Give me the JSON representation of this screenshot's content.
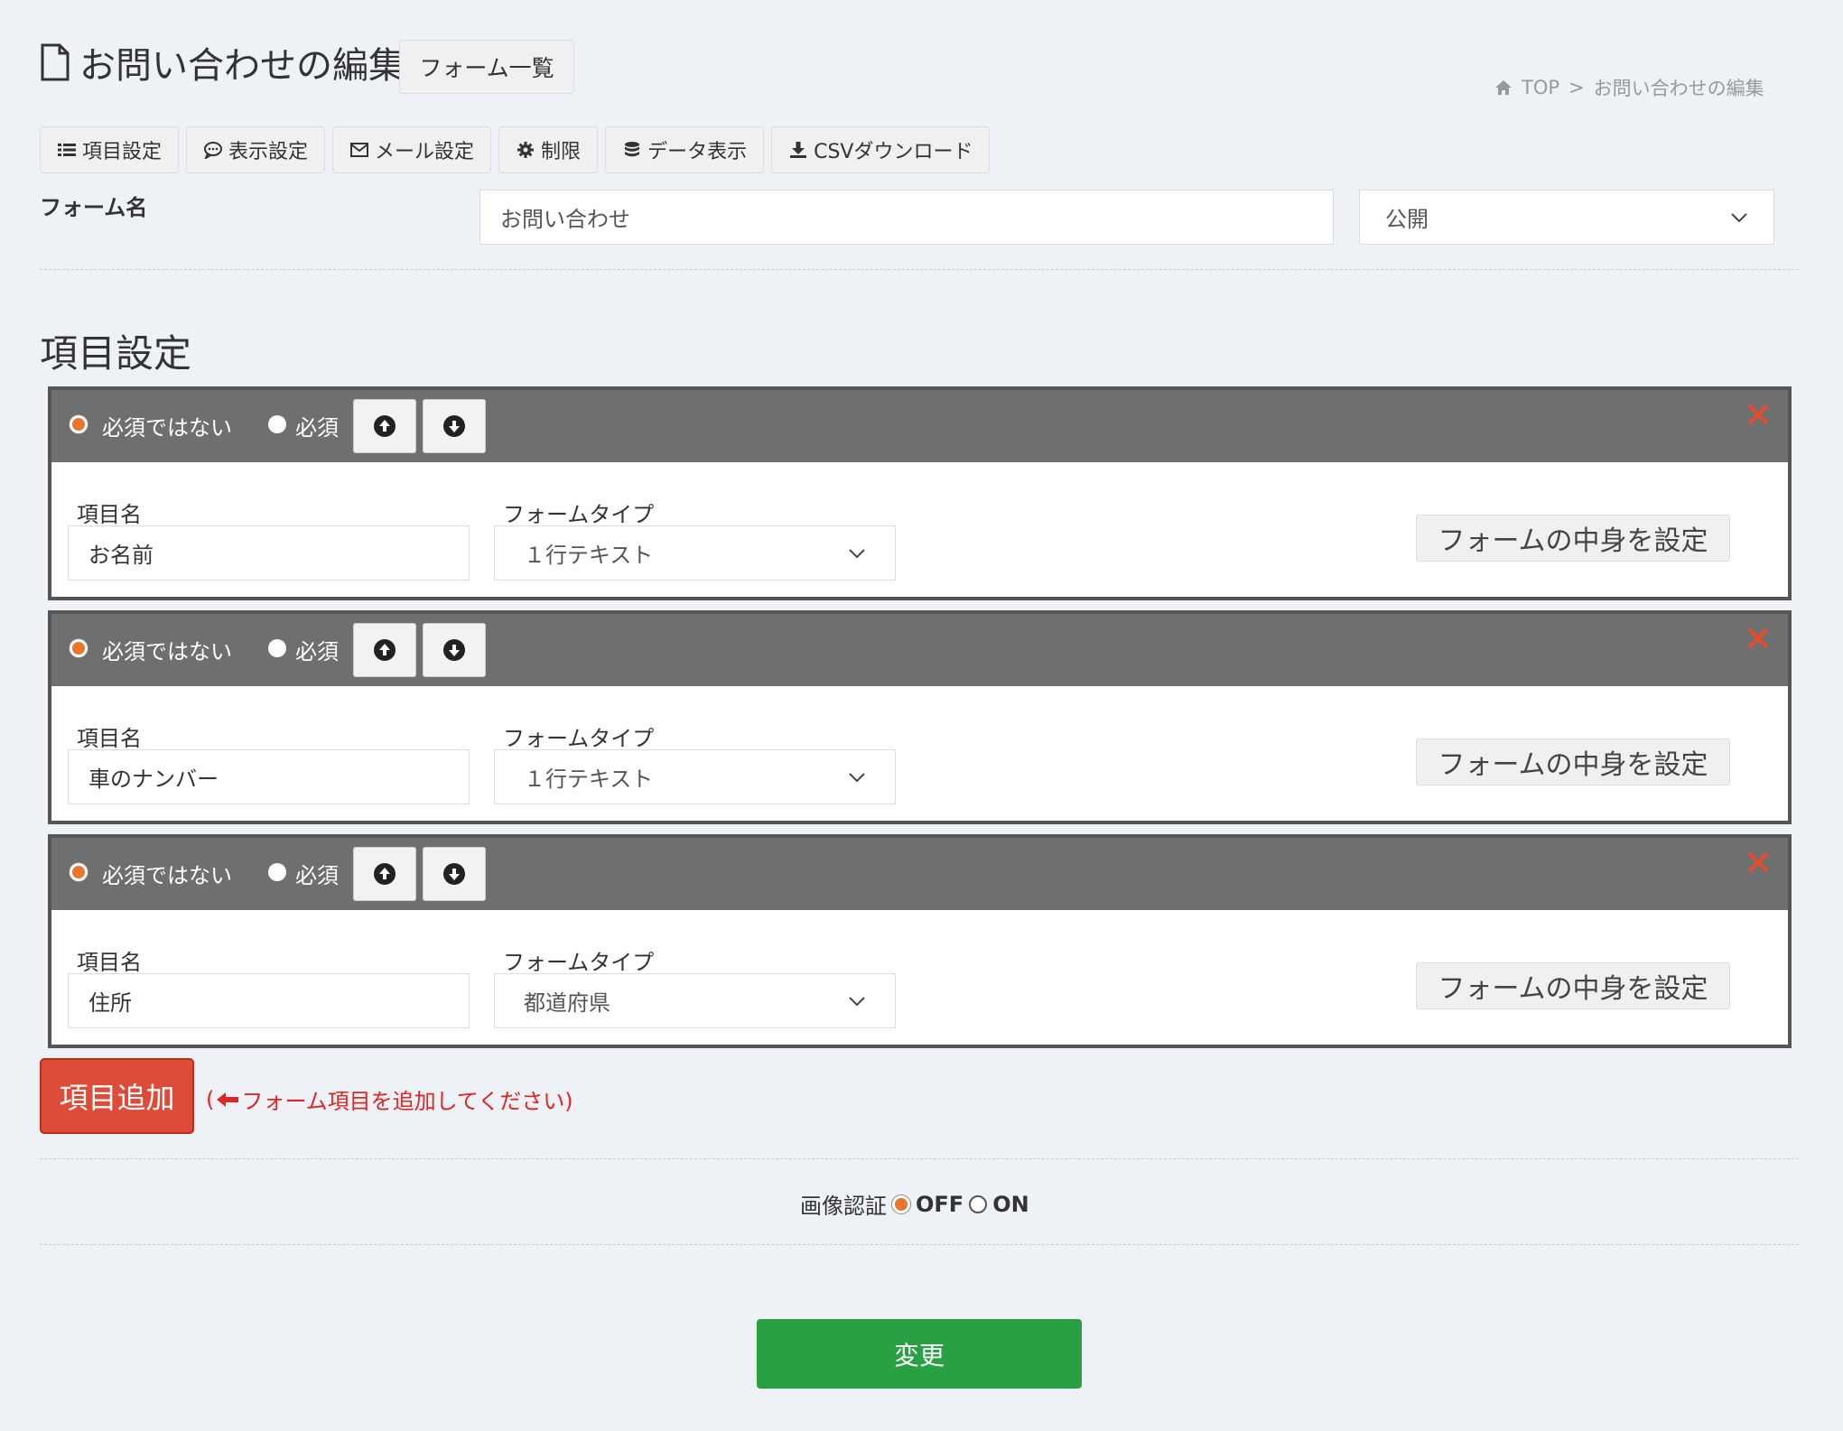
{
  "header": {
    "title": "お問い合わせの編集",
    "list_button": "フォーム一覧"
  },
  "breadcrumb": {
    "home": "TOP",
    "separator": ">",
    "current": "お問い合わせの編集"
  },
  "tabs": [
    {
      "label": "項目設定",
      "icon": "list-icon"
    },
    {
      "label": "表示設定",
      "icon": "comment-icon"
    },
    {
      "label": "メール設定",
      "icon": "envelope-icon"
    },
    {
      "label": "制限",
      "icon": "gear-icon"
    },
    {
      "label": "データ表示",
      "icon": "database-icon"
    },
    {
      "label": "CSVダウンロード",
      "icon": "download-icon"
    }
  ],
  "form": {
    "name_label": "フォーム名",
    "name_value": "お問い合わせ",
    "status_value": "公開"
  },
  "section_title": "項目設定",
  "fields": [
    {
      "not_required_label": "必須ではない",
      "required_label": "必須",
      "selected": "not_required",
      "item_name_label": "項目名",
      "item_name_value": "お名前",
      "form_type_label": "フォームタイプ",
      "form_type_value": "１行テキスト",
      "content_button": "フォームの中身を設定"
    },
    {
      "not_required_label": "必須ではない",
      "required_label": "必須",
      "selected": "not_required",
      "item_name_label": "項目名",
      "item_name_value": "車のナンバー",
      "form_type_label": "フォームタイプ",
      "form_type_value": "１行テキスト",
      "content_button": "フォームの中身を設定"
    },
    {
      "not_required_label": "必須ではない",
      "required_label": "必須",
      "selected": "not_required",
      "item_name_label": "項目名",
      "item_name_value": "住所",
      "form_type_label": "フォームタイプ",
      "form_type_value": "都道府県",
      "content_button": "フォームの中身を設定"
    }
  ],
  "add_item": {
    "button": "項目追加",
    "hint_open": "(",
    "hint_text": "フォーム項目を追加してください)"
  },
  "captcha": {
    "label": "画像認証",
    "off_label": "OFF",
    "on_label": "ON",
    "selected": "OFF"
  },
  "submit": {
    "label": "変更"
  },
  "colors": {
    "background": "#eef1f5",
    "field_header": "#6f6f6f",
    "add_button": "#de4b39",
    "submit_button": "#29a043",
    "radio_checked": "#e8762d",
    "close_x": "#e84c2b",
    "hint_text": "#e02424"
  }
}
